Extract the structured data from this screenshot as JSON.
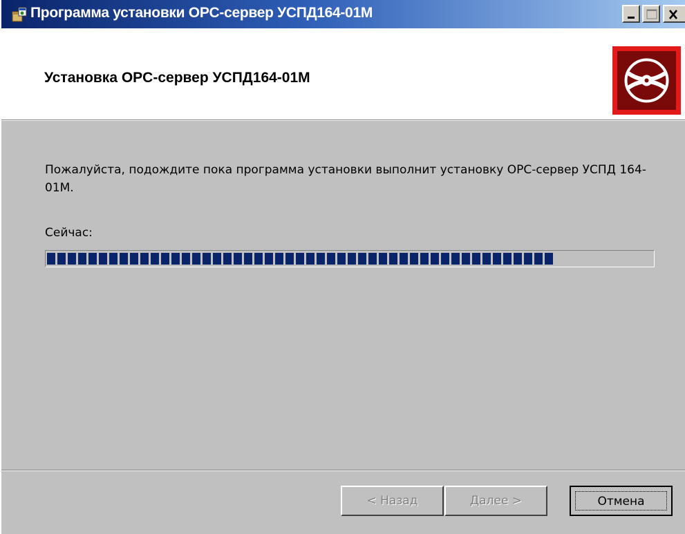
{
  "window": {
    "title": "Программа установки OPC-сервер УСПД164-01М"
  },
  "header": {
    "title": "Установка OPC-сервер УСПД164-01М",
    "logo_icon": "install-disc-icon"
  },
  "body": {
    "message": "Пожалуйста, подождите пока программа установки выполнит установку OPC-сервер УСПД 164-01М.",
    "now_label": "Сейчас:",
    "progress": 0.84
  },
  "buttons": {
    "back": "< Назад",
    "next": "Далее >",
    "cancel": "Отмена"
  },
  "colors": {
    "title_bar_start": "#0a246a",
    "title_bar_end": "#a6caf0",
    "progress_fill": "#0a246a",
    "logo_frame": "#e21a1a",
    "logo_fill": "#7a0a0a",
    "dialog_face": "#c0c0c0"
  }
}
